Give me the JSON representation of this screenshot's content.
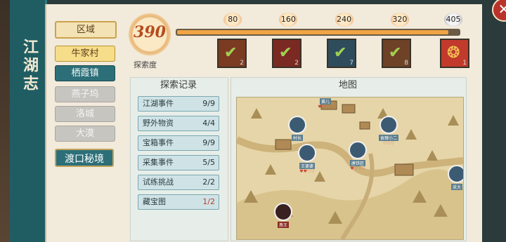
{
  "panel": {
    "title": "江湖志",
    "close_icon": "close-icon"
  },
  "regions": {
    "header": "区域",
    "items": [
      {
        "label": "牛家村",
        "state": "gold"
      },
      {
        "label": "栖霞镇",
        "state": "selected"
      },
      {
        "label": "燕子坞",
        "state": "locked"
      },
      {
        "label": "洛城",
        "state": "locked"
      },
      {
        "label": "大漠",
        "state": "locked"
      }
    ],
    "ferry_label": "渡口秘境"
  },
  "explore": {
    "value": "390",
    "label": "探索度",
    "max": 405,
    "progress_fraction": 0.963,
    "milestones": [
      {
        "value": "80",
        "reward": "check",
        "count": "2",
        "color": "#7a3b22"
      },
      {
        "value": "160",
        "reward": "check",
        "count": "2",
        "color": "#7a2a22"
      },
      {
        "value": "240",
        "reward": "check",
        "count": "7",
        "color": "#2e4c5c"
      },
      {
        "value": "320",
        "reward": "check",
        "count": "8",
        "color": "#6d4226"
      },
      {
        "value": "405",
        "reward": "gold-ornament",
        "count": "1",
        "color": "#c23a2c"
      }
    ]
  },
  "records": {
    "header": "探索记录",
    "rows": [
      {
        "name": "江湖事件",
        "value": "9/9",
        "complete": true
      },
      {
        "name": "野外物资",
        "value": "4/4",
        "complete": true
      },
      {
        "name": "宝箱事件",
        "value": "9/9",
        "complete": true
      },
      {
        "name": "采集事件",
        "value": "5/5",
        "complete": true
      },
      {
        "name": "试练挑战",
        "value": "2/2",
        "complete": true
      },
      {
        "name": "藏宝图",
        "value": "1/2",
        "complete": false
      }
    ]
  },
  "map": {
    "header": "地图",
    "npcs": [
      {
        "name": "黄儿"
      },
      {
        "name": "村长"
      },
      {
        "name": "食肆小二"
      },
      {
        "name": "王婆婆"
      },
      {
        "name": "唐铁匠"
      },
      {
        "name": "采大"
      },
      {
        "name": "燕王"
      }
    ]
  },
  "colors": {
    "accent_teal": "#2c6f78",
    "progress_orange": "#f0a444",
    "incomplete_red": "#b83a2c"
  }
}
